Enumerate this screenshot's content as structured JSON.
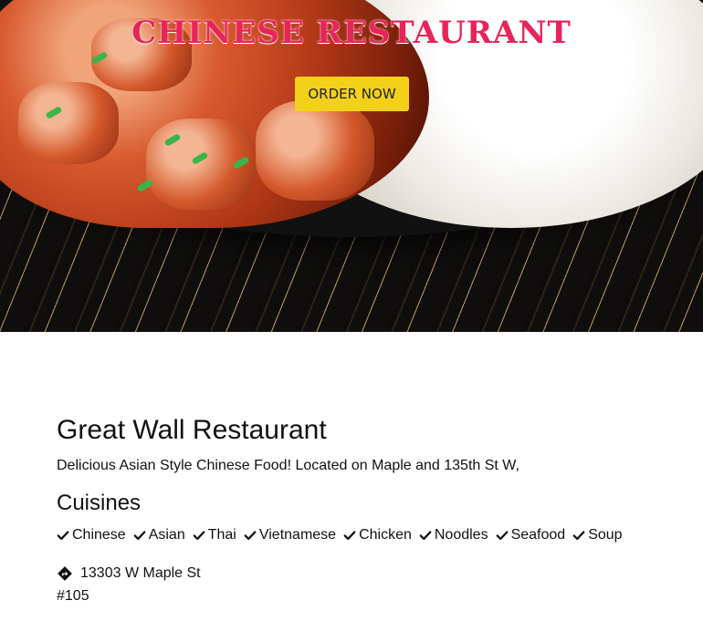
{
  "hero": {
    "title": "CHINESE RESTAURANT",
    "order_label": "ORDER NOW"
  },
  "restaurant": {
    "name": "Great Wall Restaurant",
    "description": "Delicious Asian Style Chinese Food! Located on Maple and 135th St W,"
  },
  "cuisines": {
    "title": "Cuisines",
    "items": [
      "Chinese",
      "Asian",
      "Thai",
      "Vietnamese",
      "Chicken",
      "Noodles",
      "Seafood",
      "Soup"
    ],
    "icon": "check-icon"
  },
  "address": {
    "icon": "directions-icon",
    "line1": "13303 W Maple St",
    "line2": "#105"
  },
  "colors": {
    "title": "#e8245a",
    "button": "#f3d11b"
  }
}
